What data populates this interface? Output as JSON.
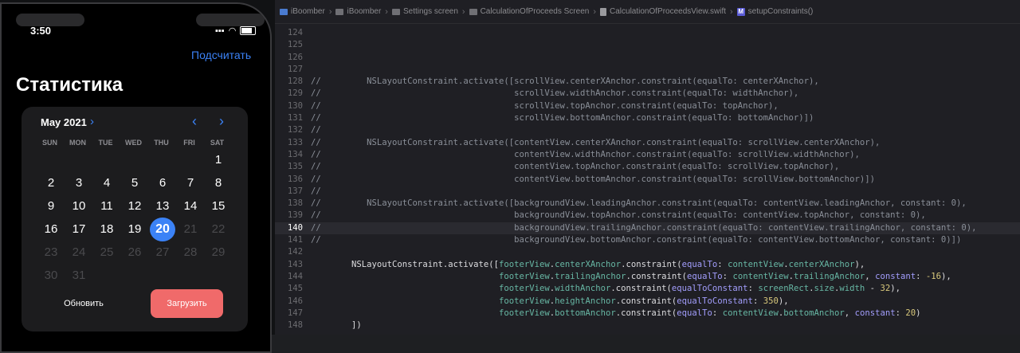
{
  "simulator": {
    "status_time": "3:50",
    "action_button": "Подсчитать",
    "title": "Статистика",
    "calendar": {
      "month_label": "May 2021",
      "weekdays": [
        "SUN",
        "MON",
        "TUE",
        "WED",
        "THU",
        "FRI",
        "SAT"
      ],
      "days": [
        {
          "label": "1",
          "state": "on"
        },
        {
          "label": "2",
          "state": "on"
        },
        {
          "label": "3",
          "state": "on"
        },
        {
          "label": "4",
          "state": "on"
        },
        {
          "label": "5",
          "state": "on"
        },
        {
          "label": "6",
          "state": "on"
        },
        {
          "label": "7",
          "state": "on"
        },
        {
          "label": "8",
          "state": "on"
        },
        {
          "label": "9",
          "state": "on"
        },
        {
          "label": "10",
          "state": "on"
        },
        {
          "label": "11",
          "state": "on"
        },
        {
          "label": "12",
          "state": "on"
        },
        {
          "label": "13",
          "state": "on"
        },
        {
          "label": "14",
          "state": "on"
        },
        {
          "label": "15",
          "state": "on"
        },
        {
          "label": "16",
          "state": "on"
        },
        {
          "label": "17",
          "state": "on"
        },
        {
          "label": "18",
          "state": "on"
        },
        {
          "label": "19",
          "state": "on"
        },
        {
          "label": "20",
          "state": "sel"
        },
        {
          "label": "21",
          "state": "off"
        },
        {
          "label": "22",
          "state": "off"
        },
        {
          "label": "23",
          "state": "off"
        },
        {
          "label": "24",
          "state": "off"
        },
        {
          "label": "25",
          "state": "off"
        },
        {
          "label": "26",
          "state": "off"
        },
        {
          "label": "27",
          "state": "off"
        },
        {
          "label": "28",
          "state": "off"
        },
        {
          "label": "29",
          "state": "off"
        },
        {
          "label": "30",
          "state": "off"
        },
        {
          "label": "31",
          "state": "off"
        }
      ],
      "first_weekday_index": 6,
      "selected_day": "20"
    },
    "refresh_button": "Обновить",
    "load_button": "Загрузить",
    "colors": {
      "accent": "#3b82f6",
      "load_button_bg": "#f06a6a"
    }
  },
  "editor": {
    "breadcrumbs": [
      {
        "label": "iBoomber",
        "icon": "project-icon"
      },
      {
        "label": "iBoomber",
        "icon": "folder-icon"
      },
      {
        "label": "Settings screen",
        "icon": "folder-icon"
      },
      {
        "label": "CalculationOfProceeds Screen",
        "icon": "folder-icon"
      },
      {
        "label": "CalculationOfProceedsView.swift",
        "icon": "swift-file-icon"
      },
      {
        "label": "setupConstraints()",
        "icon": "method-icon"
      }
    ],
    "current_line": "140",
    "lines": [
      {
        "n": "124",
        "t": ""
      },
      {
        "n": "125",
        "t": ""
      },
      {
        "n": "126",
        "t": ""
      },
      {
        "n": "127",
        "t": ""
      },
      {
        "n": "128",
        "t": "//         NSLayoutConstraint.activate([scrollView.centerXAnchor.constraint(equalTo: centerXAnchor),"
      },
      {
        "n": "129",
        "t": "//                                      scrollView.widthAnchor.constraint(equalTo: widthAnchor),"
      },
      {
        "n": "130",
        "t": "//                                      scrollView.topAnchor.constraint(equalTo: topAnchor),"
      },
      {
        "n": "131",
        "t": "//                                      scrollView.bottomAnchor.constraint(equalTo: bottomAnchor)])"
      },
      {
        "n": "132",
        "t": "//"
      },
      {
        "n": "133",
        "t": "//         NSLayoutConstraint.activate([contentView.centerXAnchor.constraint(equalTo: scrollView.centerXAnchor),"
      },
      {
        "n": "134",
        "t": "//                                      contentView.widthAnchor.constraint(equalTo: scrollView.widthAnchor),"
      },
      {
        "n": "135",
        "t": "//                                      contentView.topAnchor.constraint(equalTo: scrollView.topAnchor),"
      },
      {
        "n": "136",
        "t": "//                                      contentView.bottomAnchor.constraint(equalTo: scrollView.bottomAnchor)])"
      },
      {
        "n": "137",
        "t": "//"
      },
      {
        "n": "138",
        "t": "//         NSLayoutConstraint.activate([backgroundView.leadingAnchor.constraint(equalTo: contentView.leadingAnchor, constant: 0),"
      },
      {
        "n": "139",
        "t": "//                                      backgroundView.topAnchor.constraint(equalTo: contentView.topAnchor, constant: 0),"
      },
      {
        "n": "140",
        "t": "//                                      backgroundView.trailingAnchor.constraint(equalTo: contentView.trailingAnchor, constant: 0),"
      },
      {
        "n": "141",
        "t": "//                                      backgroundView.bottomAnchor.constraint(equalTo: contentView.bottomAnchor, constant: 0)])"
      },
      {
        "n": "142",
        "t": ""
      },
      {
        "n": "143",
        "t": "        NSLayoutConstraint.activate([footerView.centerXAnchor.constraint(equalTo: contentView.centerXAnchor),"
      },
      {
        "n": "144",
        "t": "                                     footerView.trailingAnchor.constraint(equalTo: contentView.trailingAnchor, constant: -16),"
      },
      {
        "n": "145",
        "t": "                                     footerView.widthAnchor.constraint(equalToConstant: screenRect.size.width - 32),"
      },
      {
        "n": "146",
        "t": "                                     footerView.heightAnchor.constraint(equalToConstant: 350),"
      },
      {
        "n": "147",
        "t": "                                     footerView.bottomAnchor.constraint(equalTo: contentView.bottomAnchor, constant: 20)"
      },
      {
        "n": "148",
        "t": "        ])"
      }
    ]
  }
}
